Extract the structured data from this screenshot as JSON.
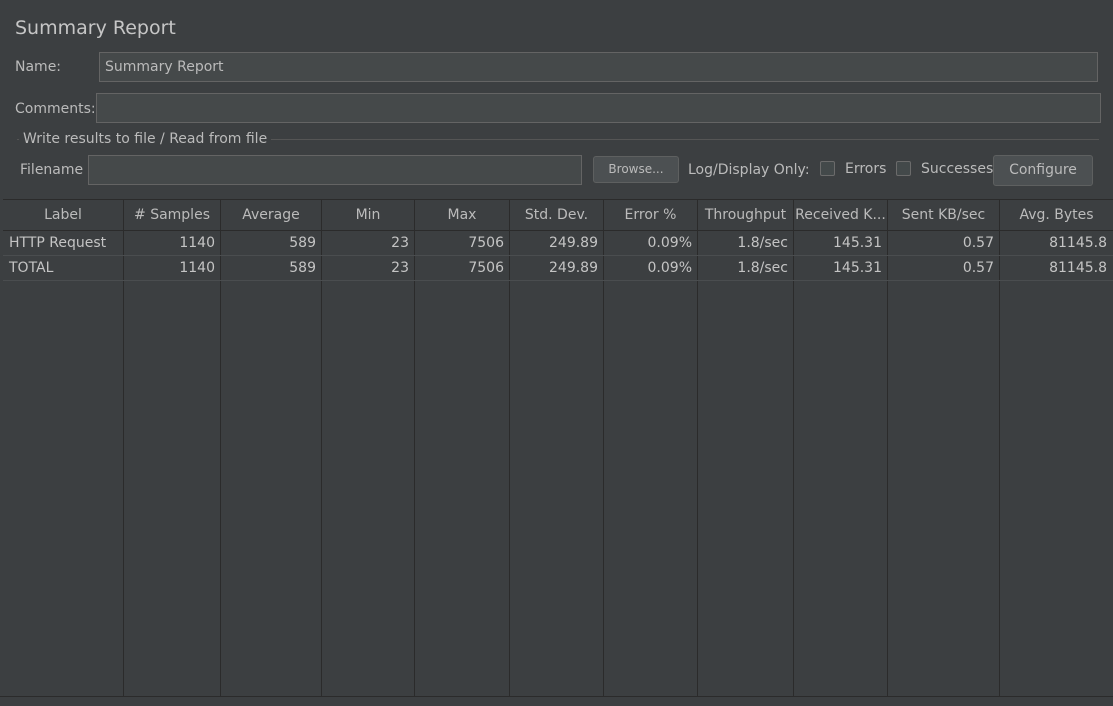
{
  "panel": {
    "title": "Summary Report",
    "name_label": "Name:",
    "name_value": "Summary Report",
    "comments_label": "Comments:",
    "comments_value": "",
    "group_title": "Write results to file / Read from file",
    "filename_label": "Filename",
    "filename_value": "",
    "browse_label": "Browse...",
    "log_display_label": "Log/Display Only:",
    "errors_label": "Errors",
    "errors_checked": false,
    "successes_label": "Successes",
    "successes_checked": false,
    "configure_label": "Configure"
  },
  "table": {
    "headers": [
      "Label",
      "# Samples",
      "Average",
      "Min",
      "Max",
      "Std. Dev.",
      "Error %",
      "Throughput",
      "Received K...",
      "Sent KB/sec",
      "Avg. Bytes"
    ],
    "rows": [
      [
        "HTTP Request",
        "1140",
        "589",
        "23",
        "7506",
        "249.89",
        "0.09%",
        "1.8/sec",
        "145.31",
        "0.57",
        "81145.8"
      ],
      [
        "TOTAL",
        "1140",
        "589",
        "23",
        "7506",
        "249.89",
        "0.09%",
        "1.8/sec",
        "145.31",
        "0.57",
        "81145.8"
      ]
    ]
  },
  "colors": {
    "background": "#3c3f41",
    "field": "#45494a",
    "text": "#bbbbbb",
    "grid": "#2b2b2b"
  }
}
